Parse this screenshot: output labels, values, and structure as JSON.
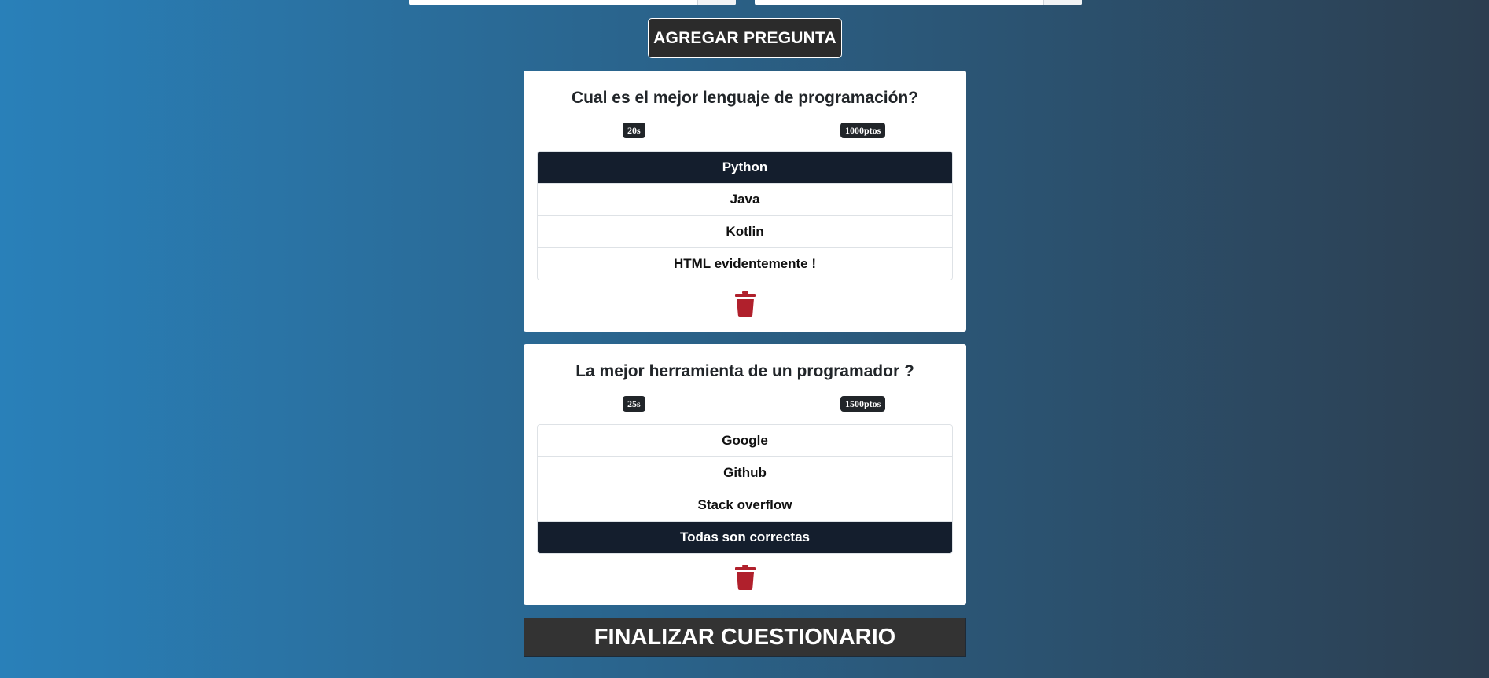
{
  "toolbar": {
    "add_question_label": "AGREGAR PREGUNTA"
  },
  "questions": [
    {
      "title": "Cual es el mejor lenguaje de programación?",
      "time": "20s",
      "points": "1000ptos",
      "answers": [
        "Python",
        "Java",
        "Kotlin",
        "HTML evidentemente !"
      ],
      "correct_index": 0
    },
    {
      "title": "La mejor herramienta de un programador ?",
      "time": "25s",
      "points": "1500ptos",
      "answers": [
        "Google",
        "Github",
        "Stack overflow",
        "Todas son correctas"
      ],
      "correct_index": 3
    }
  ],
  "footer": {
    "finish_label": "FINALIZAR CUESTIONARIO"
  },
  "colors": {
    "background_start": "#2980b9",
    "background_end": "#2c3e50",
    "correct_answer_bg": "#141e2d",
    "badge_bg": "#212529",
    "delete_icon": "#b0202c"
  },
  "icons": {
    "delete": "trash-icon"
  }
}
